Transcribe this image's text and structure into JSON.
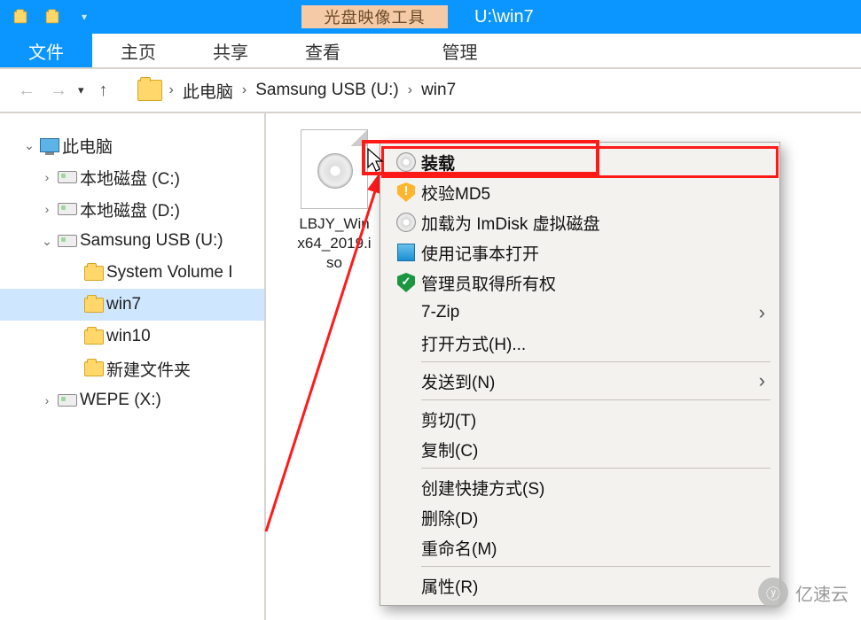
{
  "titlebar": {
    "context_tab": "光盘映像工具",
    "location": "U:\\win7"
  },
  "ribbon": {
    "file": "文件",
    "home": "主页",
    "share": "共享",
    "view": "查看",
    "manage": "管理"
  },
  "breadcrumb": {
    "parts": [
      "此电脑",
      "Samsung USB (U:)",
      "win7"
    ]
  },
  "tree": {
    "root": "此电脑",
    "items": [
      {
        "label": "本地磁盘 (C:)",
        "type": "disk"
      },
      {
        "label": "本地磁盘 (D:)",
        "type": "disk"
      },
      {
        "label": "Samsung USB (U:)",
        "type": "disk",
        "expanded": true,
        "children": [
          {
            "label": "System Volume I",
            "type": "folder"
          },
          {
            "label": "win7",
            "type": "folder",
            "selected": true
          },
          {
            "label": "win10",
            "type": "folder"
          },
          {
            "label": "新建文件夹",
            "type": "folder"
          }
        ]
      },
      {
        "label": "WEPE (X:)",
        "type": "disk"
      }
    ]
  },
  "file": {
    "name": "LBJY_Win_x64_2019.iso",
    "name_line1": "LBJY_Win",
    "name_line2": "x64_2019.i",
    "name_line3": "so"
  },
  "context_menu": {
    "mount": "装载",
    "md5": "校验MD5",
    "imdisk": "加载为 ImDisk 虚拟磁盘",
    "notepad": "使用记事本打开",
    "admin_own": "管理员取得所有权",
    "sevenzip": "7-Zip",
    "open_with": "打开方式(H)...",
    "send_to": "发送到(N)",
    "cut": "剪切(T)",
    "copy": "复制(C)",
    "shortcut": "创建快捷方式(S)",
    "delete": "删除(D)",
    "rename": "重命名(M)",
    "props": "属性(R)"
  },
  "watermark": {
    "text": "亿速云"
  }
}
